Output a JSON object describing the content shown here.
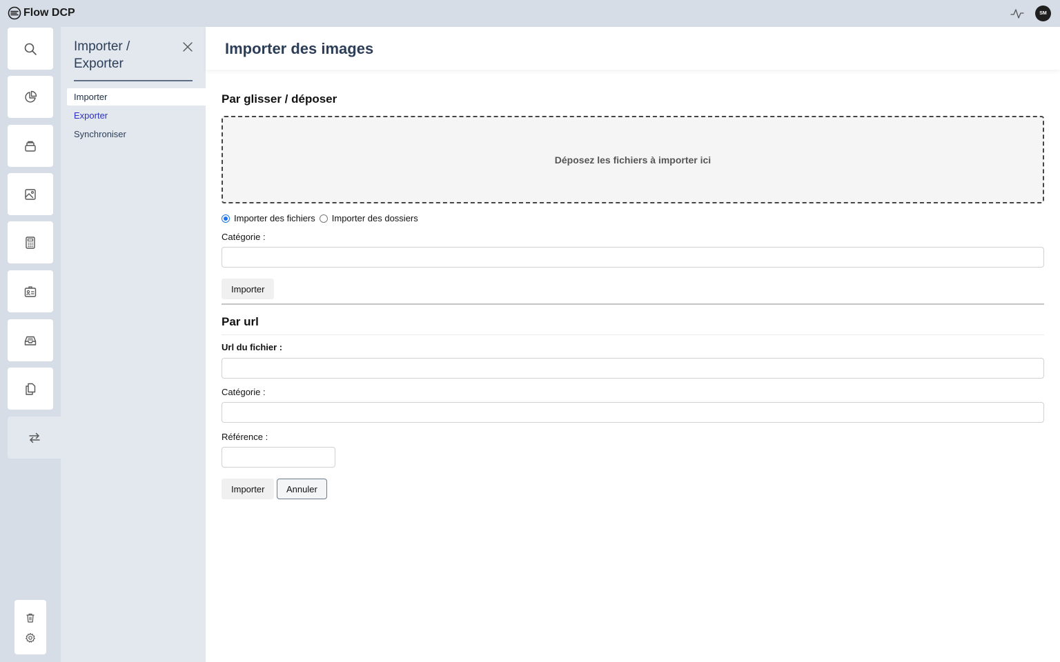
{
  "app": {
    "title": "Flow DCP",
    "user_initials": "SM"
  },
  "rail": {
    "items": [
      {
        "icon": "search-icon"
      },
      {
        "icon": "pie-chart-icon"
      },
      {
        "icon": "stack-icon"
      },
      {
        "icon": "image-icon"
      },
      {
        "icon": "calculator-icon"
      },
      {
        "icon": "id-card-icon"
      },
      {
        "icon": "inbox-icon"
      },
      {
        "icon": "copy-icon"
      },
      {
        "icon": "import-export-icon",
        "active": true
      }
    ],
    "bottom": [
      {
        "icon": "trash-icon"
      },
      {
        "icon": "settings-icon"
      }
    ]
  },
  "subpanel": {
    "title": "Importer / Exporter",
    "items": [
      {
        "label": "Importer",
        "state": "selected"
      },
      {
        "label": "Exporter",
        "state": "link"
      },
      {
        "label": "Synchroniser",
        "state": "plain"
      }
    ]
  },
  "main": {
    "title": "Importer des images",
    "drag_section": {
      "title": "Par glisser / déposer",
      "dropzone_text": "Déposez les fichiers à importer ici",
      "radio_files": "Importer des fichiers",
      "radio_folders": "Importer des dossiers",
      "selected_mode": "files",
      "category_label": "Catégorie :",
      "category_value": "",
      "import_button": "Importer"
    },
    "url_section": {
      "title": "Par url",
      "url_label": "Url du fichier :",
      "url_value": "",
      "category_label": "Catégorie :",
      "category_value": "",
      "reference_label": "Référence :",
      "reference_value": "",
      "import_button": "Importer",
      "cancel_button": "Annuler"
    }
  },
  "colors": {
    "background": "#d6dde7",
    "panel": "#e3e8ef",
    "title": "#2c3e57",
    "link": "#2d2fbf",
    "accent": "#1a73e8"
  }
}
